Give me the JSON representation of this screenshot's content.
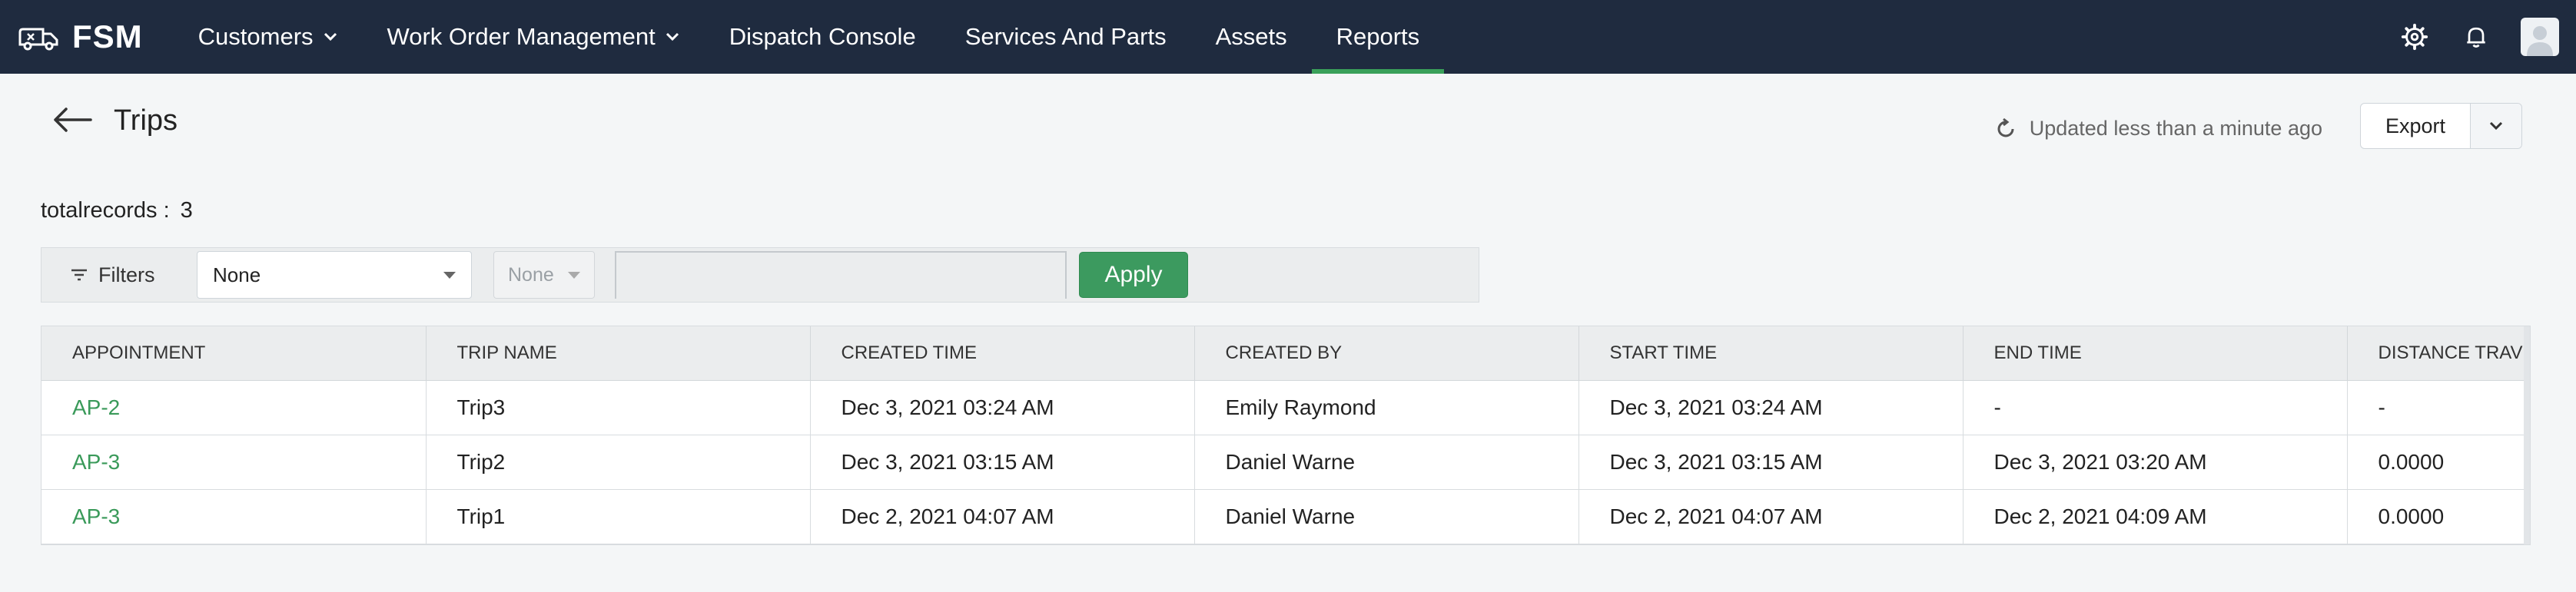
{
  "brand": {
    "name": "FSM"
  },
  "nav": {
    "items": [
      {
        "label": "Customers",
        "has_dropdown": true,
        "active": false
      },
      {
        "label": "Work Order Management",
        "has_dropdown": true,
        "active": false
      },
      {
        "label": "Dispatch Console",
        "has_dropdown": false,
        "active": false
      },
      {
        "label": "Services And Parts",
        "has_dropdown": false,
        "active": false
      },
      {
        "label": "Assets",
        "has_dropdown": false,
        "active": false
      },
      {
        "label": "Reports",
        "has_dropdown": false,
        "active": true
      }
    ],
    "right_icons": [
      "gear-icon",
      "bell-icon",
      "avatar"
    ]
  },
  "page": {
    "title": "Trips",
    "updated_text": "Updated less than a minute ago",
    "export_label": "Export"
  },
  "summary": {
    "label": "totalrecords :",
    "value": "3"
  },
  "filters": {
    "label": "Filters",
    "field_value": "None",
    "operator_value": "None",
    "value_input": "",
    "apply_label": "Apply"
  },
  "table": {
    "columns": [
      "APPOINTMENT",
      "TRIP NAME",
      "CREATED TIME",
      "CREATED BY",
      "START TIME",
      "END TIME",
      "DISTANCE TRAVELLED"
    ],
    "rows": [
      [
        "AP-2",
        "Trip3",
        "Dec 3, 2021 03:24 AM",
        "Emily Raymond",
        "Dec 3, 2021 03:24 AM",
        "-",
        "-"
      ],
      [
        "AP-3",
        "Trip2",
        "Dec 3, 2021 03:15 AM",
        "Daniel Warne",
        "Dec 3, 2021 03:15 AM",
        "Dec 3, 2021 03:20 AM",
        "0.0000"
      ],
      [
        "AP-3",
        "Trip1",
        "Dec 2, 2021 04:07 AM",
        "Daniel Warne",
        "Dec 2, 2021 04:07 AM",
        "Dec 2, 2021 04:09 AM",
        "0.0000"
      ]
    ]
  },
  "colors": {
    "nav_bg": "#1f2b3f",
    "accent_green": "#3a9a5a",
    "page_bg": "#f4f6f7"
  }
}
